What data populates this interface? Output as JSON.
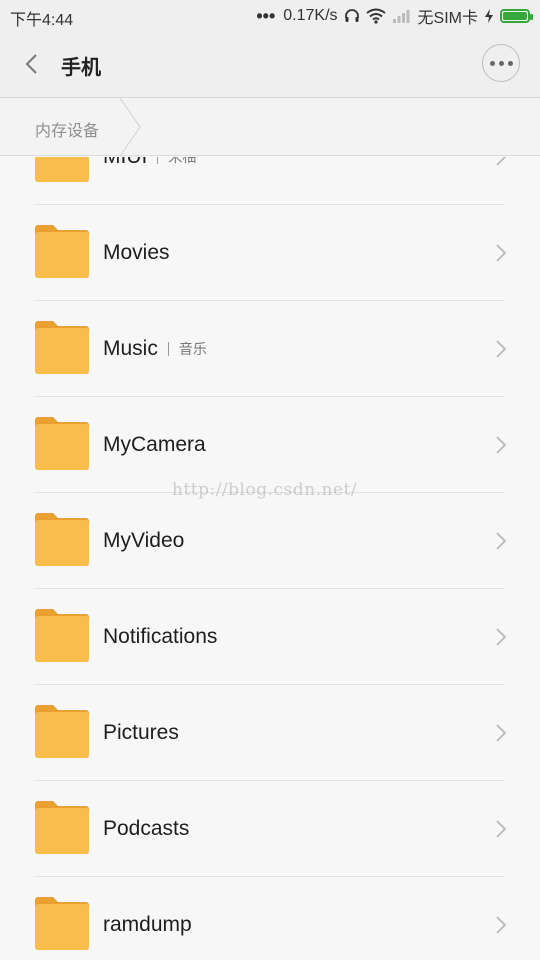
{
  "status_bar": {
    "time": "下午4:44",
    "network_speed": "0.17K/s",
    "sim": "无SIM卡",
    "signal_dots": "•••"
  },
  "title_bar": {
    "title": "手机"
  },
  "breadcrumb": {
    "item": "内存设备"
  },
  "folders": [
    {
      "name": "MIUI",
      "sub": "米柚"
    },
    {
      "name": "Movies",
      "sub": ""
    },
    {
      "name": "Music",
      "sub": "音乐"
    },
    {
      "name": "MyCamera",
      "sub": ""
    },
    {
      "name": "MyVideo",
      "sub": ""
    },
    {
      "name": "Notifications",
      "sub": ""
    },
    {
      "name": "Pictures",
      "sub": ""
    },
    {
      "name": "Podcasts",
      "sub": ""
    },
    {
      "name": "ramdump",
      "sub": ""
    }
  ],
  "watermark": "http://blog.csdn.net/",
  "colors": {
    "folder": "#f9bd4b",
    "folder_tab": "#e9a030",
    "battery": "#37a83a"
  }
}
